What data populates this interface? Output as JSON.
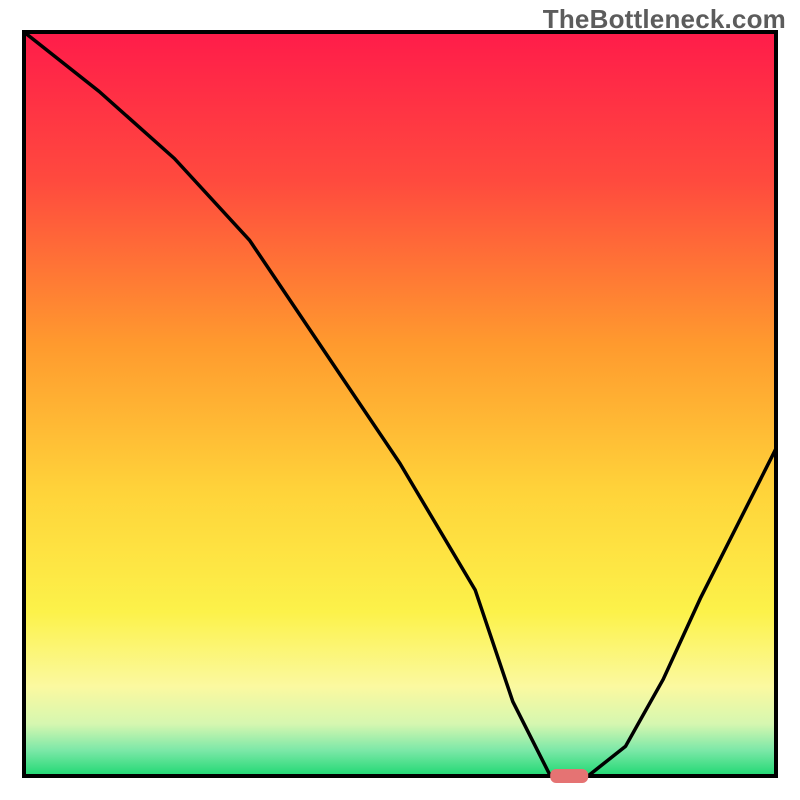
{
  "watermark": "TheBottleneck.com",
  "chart_data": {
    "type": "line",
    "title": "",
    "xlabel": "",
    "ylabel": "",
    "xlim": [
      0,
      100
    ],
    "ylim": [
      0,
      100
    ],
    "grid": false,
    "legend": false,
    "series": [
      {
        "name": "bottleneck-curve",
        "x": [
          0,
          10,
          20,
          30,
          40,
          50,
          60,
          65,
          70,
          75,
          80,
          85,
          90,
          95,
          100
        ],
        "y": [
          100,
          92,
          83,
          72,
          57,
          42,
          25,
          10,
          0,
          0,
          4,
          13,
          24,
          34,
          44
        ]
      }
    ],
    "marker": {
      "name": "optimum-marker",
      "x": 72.5,
      "y": 0,
      "color": "#e57373",
      "shape": "pill"
    },
    "background_gradient": {
      "type": "vertical",
      "stops": [
        {
          "pos": 0.0,
          "color": "#ff1c4a"
        },
        {
          "pos": 0.2,
          "color": "#ff4a3e"
        },
        {
          "pos": 0.42,
          "color": "#ff9a2e"
        },
        {
          "pos": 0.62,
          "color": "#ffd43a"
        },
        {
          "pos": 0.78,
          "color": "#fcf24a"
        },
        {
          "pos": 0.88,
          "color": "#fbf9a0"
        },
        {
          "pos": 0.93,
          "color": "#d6f7b0"
        },
        {
          "pos": 0.965,
          "color": "#7de8a8"
        },
        {
          "pos": 1.0,
          "color": "#1fd873"
        }
      ]
    },
    "frame_color": "#000000"
  }
}
